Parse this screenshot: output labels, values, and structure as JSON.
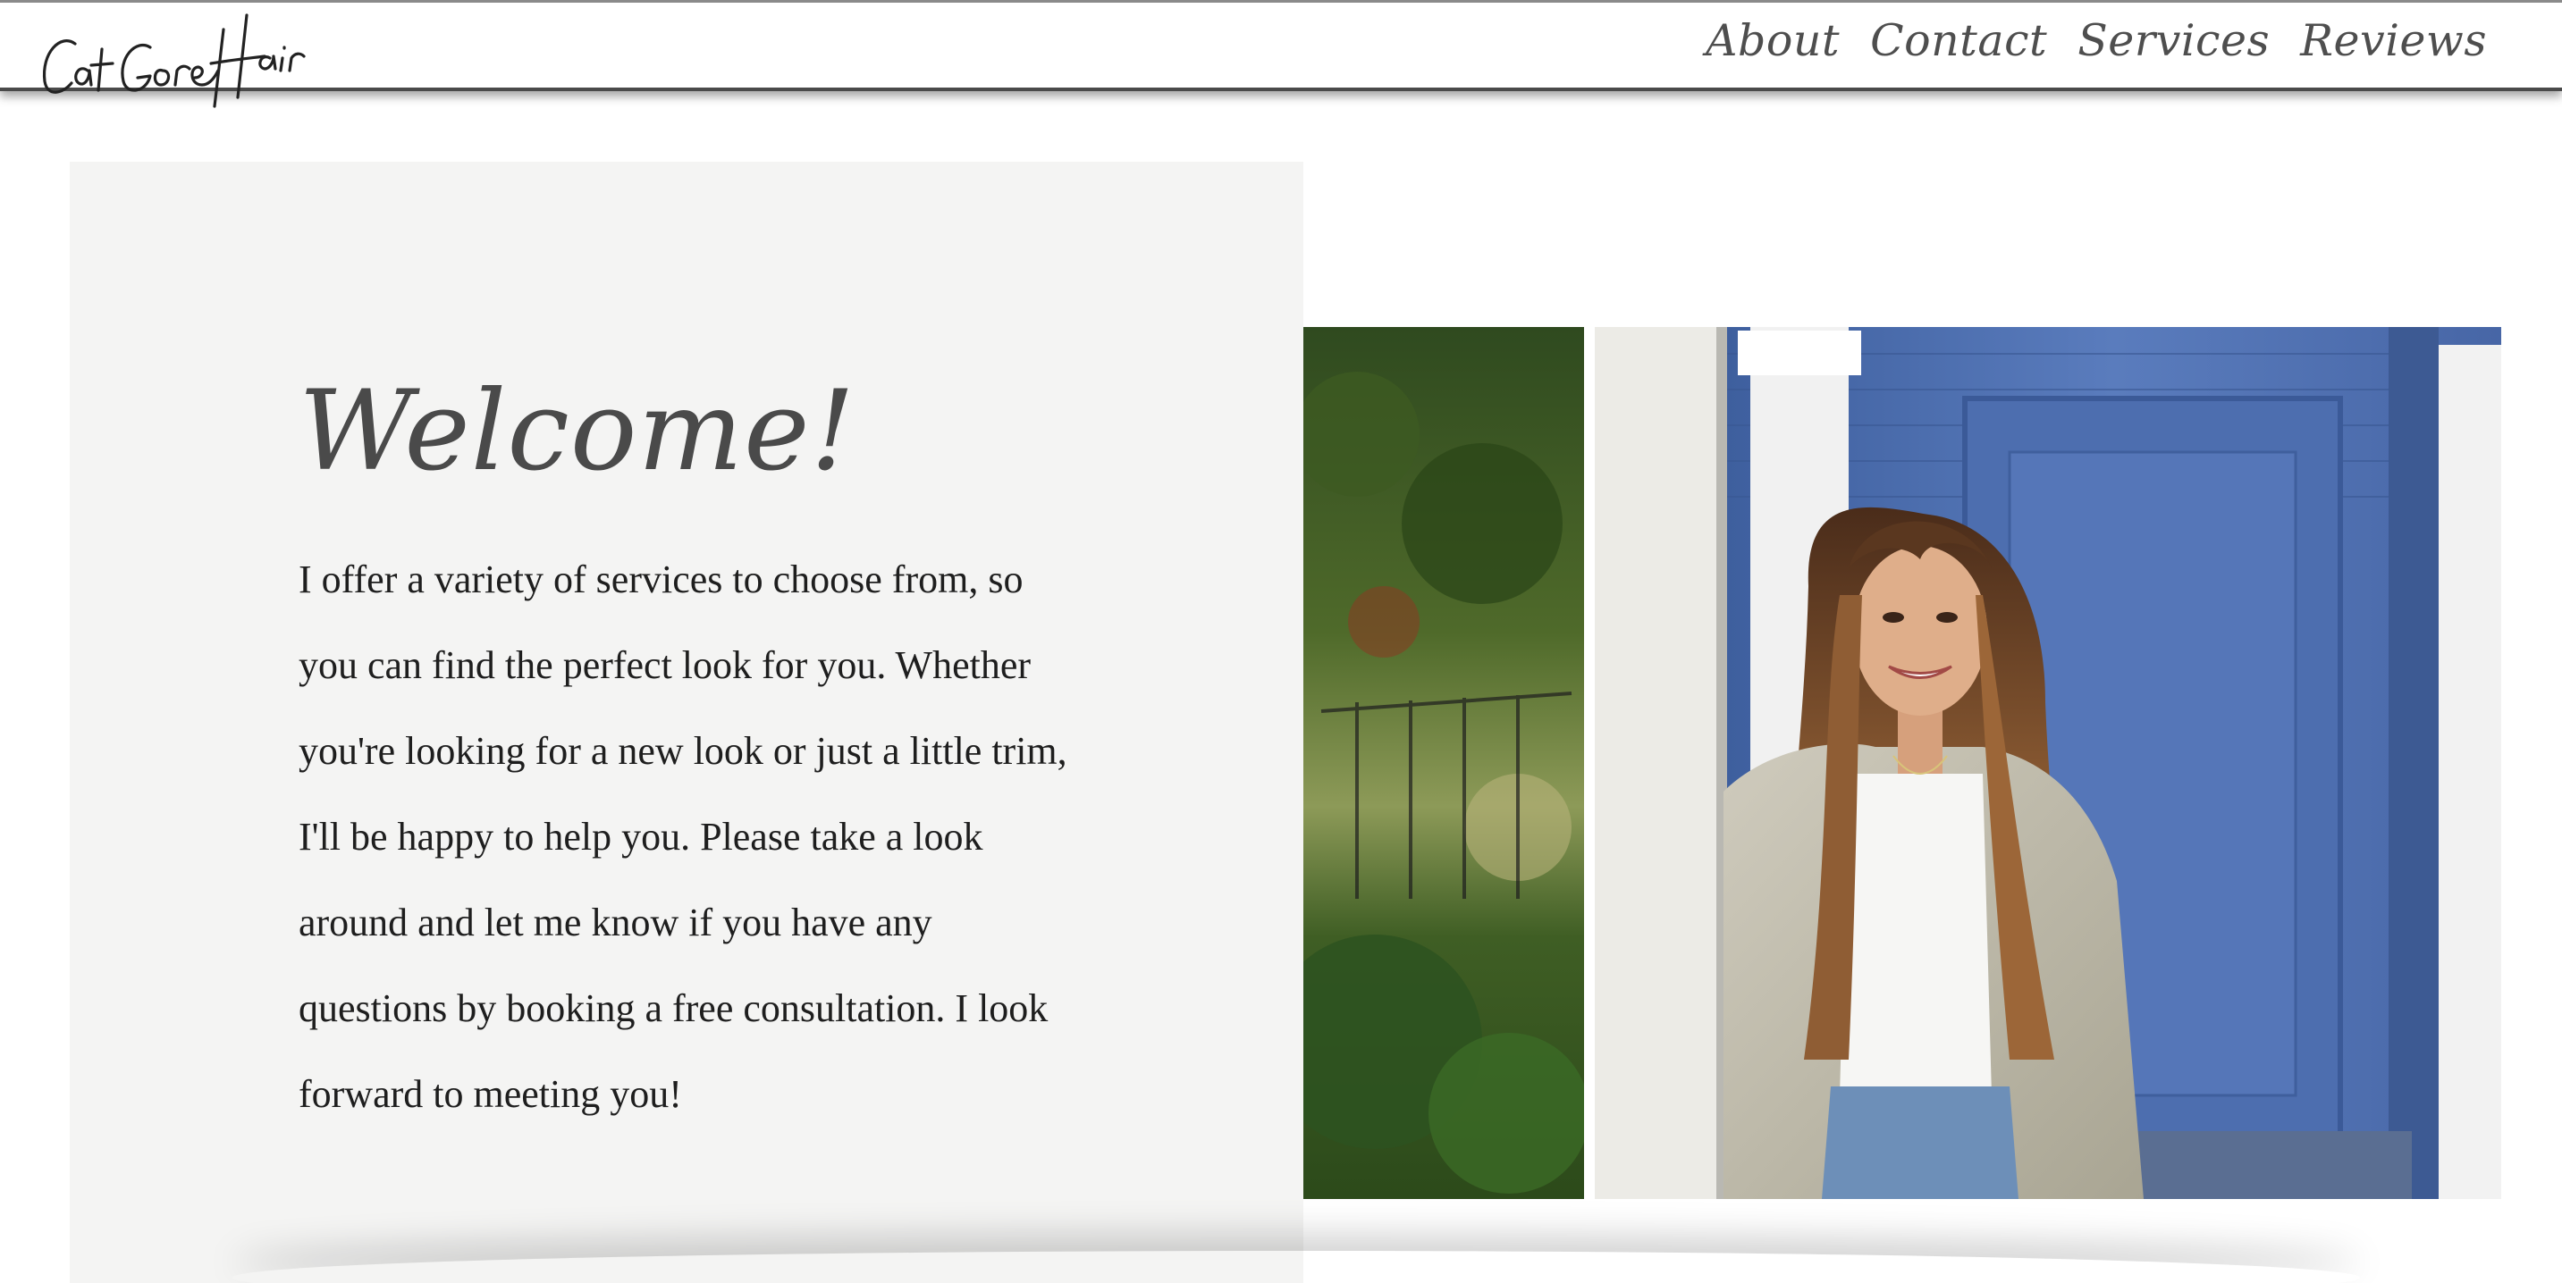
{
  "header": {
    "logo_text": "Cat Gore Hair",
    "nav": [
      {
        "label": "About"
      },
      {
        "label": "Contact"
      },
      {
        "label": "Services"
      },
      {
        "label": "Reviews"
      }
    ]
  },
  "welcome": {
    "title": "Welcome!",
    "body": "I offer a variety of services to choose from, so you can find the perfect look for you. Whether you're looking for a new look or just a little trim, I'll be happy to help you. Please take a look around and let me know if you have any questions by booking a free consultation. I look forward to meeting you!"
  },
  "photo": {
    "icon": "stylist-portrait-photo"
  },
  "colors": {
    "panel_bg": "#f4f4f3",
    "nav_text": "#4e4e4e",
    "title_text": "#4a4a4a",
    "body_text": "#1e1e1e",
    "siding_blue": "#4d6fae"
  }
}
